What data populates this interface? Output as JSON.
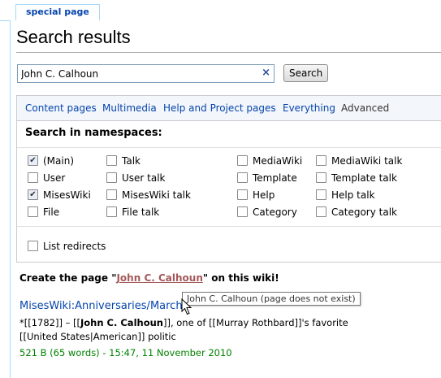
{
  "tab": {
    "label": "special page"
  },
  "page": {
    "title": "Search results"
  },
  "search": {
    "value": "John C. Calhoun",
    "button": "Search",
    "clear_icon": "×"
  },
  "types": {
    "items": [
      "Content pages",
      "Multimedia",
      "Help and Project pages",
      "Everything",
      "Advanced"
    ],
    "current": "Advanced"
  },
  "namespaces": {
    "heading": "Search in namespaces:",
    "options": [
      {
        "label": "(Main)",
        "checked": true
      },
      {
        "label": "User",
        "checked": false
      },
      {
        "label": "MisesWiki",
        "checked": true
      },
      {
        "label": "File",
        "checked": false
      },
      {
        "label": "Talk",
        "checked": false
      },
      {
        "label": "User talk",
        "checked": false
      },
      {
        "label": "MisesWiki talk",
        "checked": false
      },
      {
        "label": "File talk",
        "checked": false
      },
      {
        "label": "MediaWiki",
        "checked": false
      },
      {
        "label": "Template",
        "checked": false
      },
      {
        "label": "Help",
        "checked": false
      },
      {
        "label": "Category",
        "checked": false
      },
      {
        "label": "MediaWiki talk",
        "checked": false
      },
      {
        "label": "Template talk",
        "checked": false
      },
      {
        "label": "Help talk",
        "checked": false
      },
      {
        "label": "Category talk",
        "checked": false
      }
    ],
    "redirects_label": "List redirects"
  },
  "create": {
    "prefix": "Create the page \"",
    "link": "John C. Calhoun",
    "suffix": "\" on this wiki!",
    "tooltip": "John C. Calhoun (page does not exist)"
  },
  "result": {
    "title": "MisesWiki:Anniversaries/March",
    "snippet_a": "*[[1782]] – [[",
    "snippet_b": "John C. Calhoun",
    "snippet_c": "]], one of [[Murray Rothbard]]'s favorite [[United States|American]] politic",
    "meta": "521 B (65 words) - 15:47, 11 November 2010"
  },
  "colors": {
    "link": "#0645ad",
    "new_link": "#a55858",
    "meta": "#008000"
  }
}
